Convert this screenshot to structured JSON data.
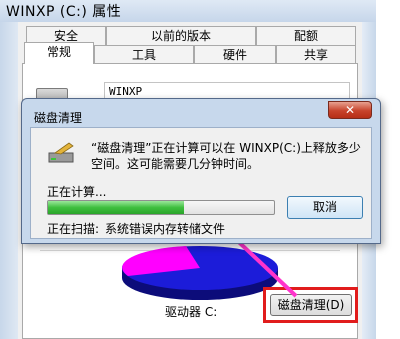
{
  "properties_window": {
    "title": "WINXP (C:) 属性",
    "tabs_row1": [
      "安全",
      "以前的版本",
      "配额"
    ],
    "tabs_row2": [
      "常规",
      "工具",
      "硬件",
      "共享"
    ],
    "active_tab": "常规",
    "drive_name_value": "WINXP",
    "drive_label": "驱动器 C:",
    "disk_cleanup_button": "磁盘清理(D)",
    "pie_used_color": "#1c1cd9",
    "pie_free_color": "#ff00ff"
  },
  "cleanup_dialog": {
    "title": "磁盘清理",
    "close_label": "✕",
    "message": "“磁盘清理”正在计算可以在 WINXP(C:)上释放多少空间。这可能需要几分钟时间。",
    "status": "正在计算...",
    "progress_fraction": 0.6,
    "cancel_label": "取消",
    "scan_label": "正在扫描:",
    "scan_item": "系统错误内存转储文件"
  },
  "annotation": {
    "highlight_color": "#e11c1c",
    "arrow_color": "#ff33cc"
  }
}
